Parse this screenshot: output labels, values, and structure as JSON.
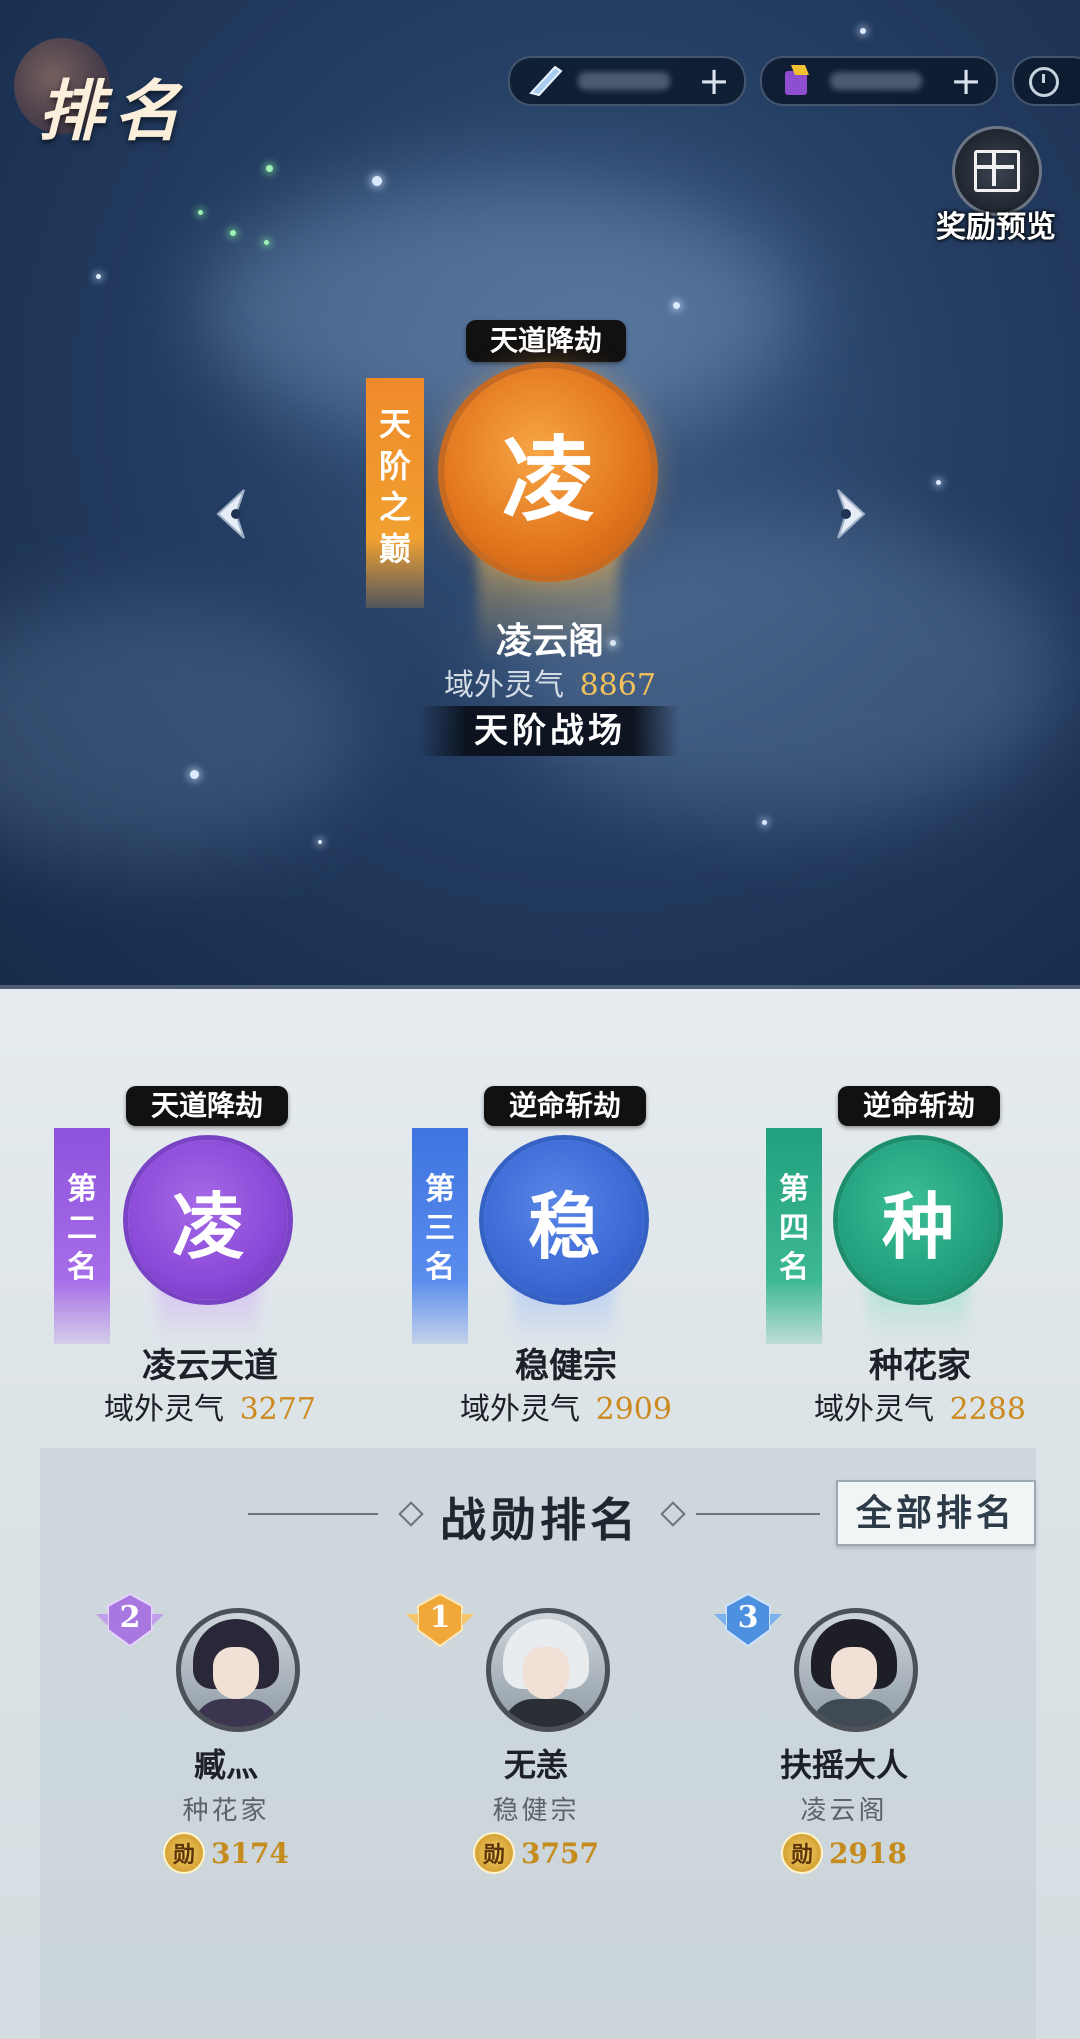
{
  "page": {
    "title": "排名"
  },
  "top_bar": {
    "resources": [
      {
        "name": "spirit-stone",
        "icon": "feather-crystal-icon"
      },
      {
        "name": "gold-ticket",
        "icon": "gold-token-icon"
      }
    ],
    "plus_label": "+"
  },
  "reward_preview": {
    "label": "奖励预览"
  },
  "champion": {
    "tag": "天道降劫",
    "banner": [
      "天",
      "阶",
      "之",
      "巅"
    ],
    "emblem_char": "凌",
    "name": "凌云阁",
    "stat_label": "域外灵气",
    "stat_value": "8867",
    "button": "天阶战场",
    "color": "#e57c1f"
  },
  "runners_up": [
    {
      "tag": "天道降劫",
      "banner": [
        "第",
        "二",
        "名"
      ],
      "emblem_char": "凌",
      "name": "凌云天道",
      "stat_label": "域外灵气",
      "stat_value": "3277",
      "color": "#8a49d8"
    },
    {
      "tag": "逆命斩劫",
      "banner": [
        "第",
        "三",
        "名"
      ],
      "emblem_char": "稳",
      "name": "稳健宗",
      "stat_label": "域外灵气",
      "stat_value": "2909",
      "color": "#3b6ad6"
    },
    {
      "tag": "逆命斩劫",
      "banner": [
        "第",
        "四",
        "名"
      ],
      "emblem_char": "种",
      "name": "种花家",
      "stat_label": "域外灵气",
      "stat_value": "2288",
      "color": "#22a07e"
    }
  ],
  "merit_ranking": {
    "title": "战勋排名",
    "all_button": "全部排名",
    "players": [
      {
        "rank": "2",
        "name": "臧灬",
        "sect": "种花家",
        "merit_icon": "勋",
        "merit": "3174",
        "badge_color": "#a878e0"
      },
      {
        "rank": "1",
        "name": "无恙",
        "sect": "稳健宗",
        "merit_icon": "勋",
        "merit": "3757",
        "badge_color": "#f0a83a"
      },
      {
        "rank": "3",
        "name": "扶摇大人",
        "sect": "凌云阁",
        "merit_icon": "勋",
        "merit": "2918",
        "badge_color": "#4e90e0"
      }
    ]
  },
  "colors": {
    "stat_value": "#f2c15a",
    "stat_value_light": "#cc8a1e"
  }
}
